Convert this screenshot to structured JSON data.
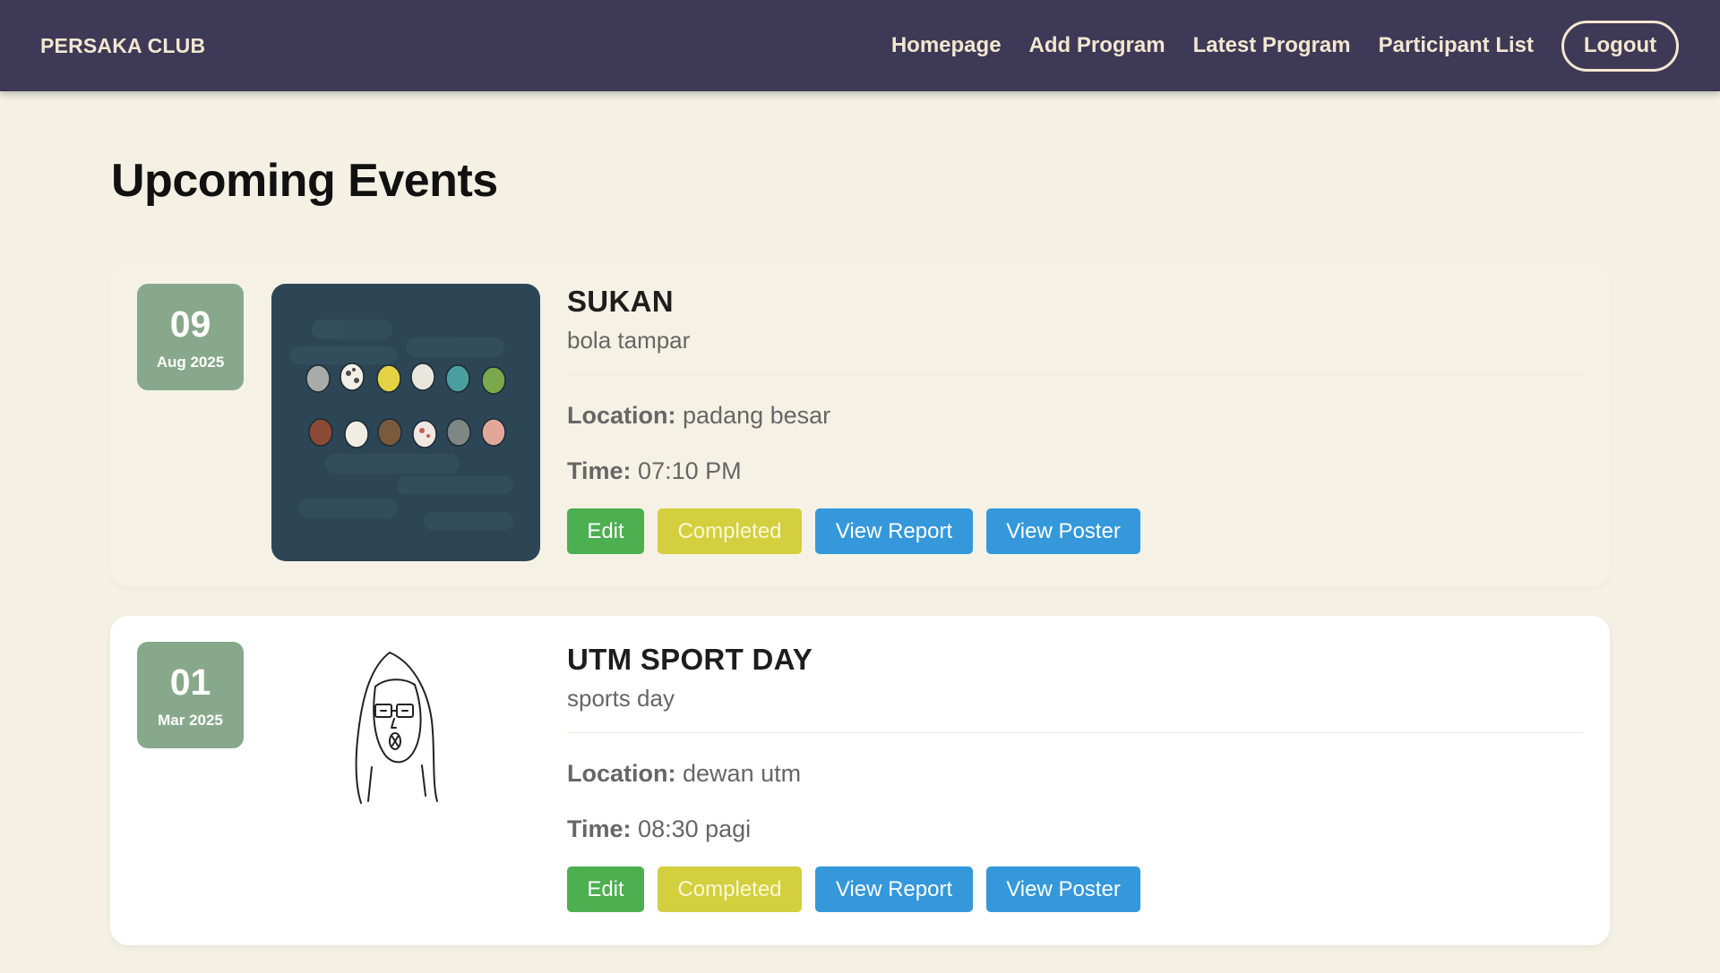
{
  "navbar": {
    "brand": "PERSAKA CLUB",
    "links": [
      "Homepage",
      "Add Program",
      "Latest Program",
      "Participant List"
    ],
    "logout": "Logout"
  },
  "page": {
    "title": "Upcoming Events"
  },
  "events": [
    {
      "day": "09",
      "month_year": "Aug 2025",
      "title": "SUKAN",
      "description": "bola tampar",
      "location_label": "Location:",
      "location": "padang besar",
      "time_label": "Time:",
      "time": "07:10 PM",
      "buttons": {
        "edit": "Edit",
        "completed": "Completed",
        "report": "View Report",
        "poster": "View Poster"
      }
    },
    {
      "day": "01",
      "month_year": "Mar 2025",
      "title": "UTM SPORT DAY",
      "description": "sports day",
      "location_label": "Location:",
      "location": "dewan utm",
      "time_label": "Time:",
      "time": "08:30 pagi",
      "buttons": {
        "edit": "Edit",
        "completed": "Completed",
        "report": "View Report",
        "poster": "View Poster"
      }
    }
  ],
  "colors": {
    "navbar_bg": "#3d3957",
    "nav_text": "#f3e7cf",
    "page_bg": "#f4f1e4",
    "date_badge": "#88a88b",
    "edit": "#4caf50",
    "completed": "#d3cf3f",
    "view": "#3498db"
  }
}
